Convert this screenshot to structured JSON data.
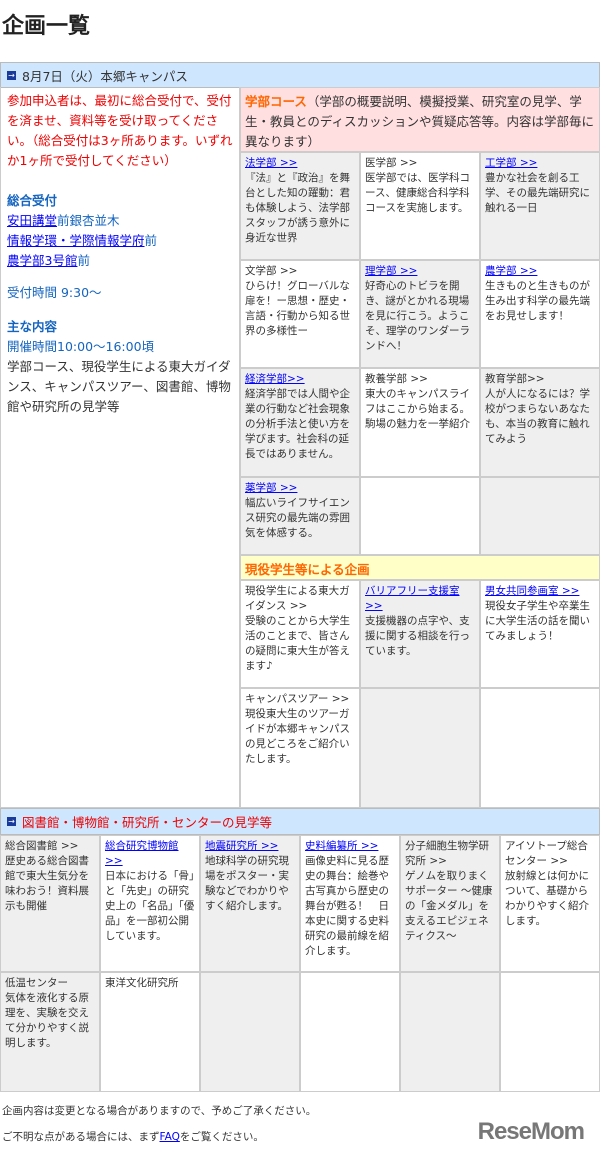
{
  "page_title": "企画一覧",
  "section1": {
    "header": "8月7日（火）本郷キャンパス",
    "notice": "参加申込者は、最初に総合受付で、受付を済ませ、資料等を受け取ってください。（総合受付は3ヶ所あります。いずれか1ヶ所で受付してください）",
    "reception_heading": "総合受付",
    "locations": [
      {
        "link": "安田講堂",
        "suffix": "前銀杏並木"
      },
      {
        "link": "情報学環・学際情報学府",
        "suffix": "前"
      },
      {
        "link": "農学部3号館",
        "suffix": "前"
      }
    ],
    "reception_time": "受付時間 9:30〜",
    "content_heading": "主な内容",
    "open_time": "開催時間10:00〜16:00頃",
    "content_desc": "学部コース、現役学生による東大ガイダンス、キャンパスツアー、図書館、博物館や研究所の見学等",
    "faculty_title": "学部コース",
    "faculty_desc": "（学部の概要説明、模擬授業、研究室の見学、学生・教員とのディスカッションや質疑応答等。内容は学部毎に異なります）",
    "faculty_cells": [
      {
        "title": "法学部 >>",
        "link": true,
        "gray": true,
        "desc": "『法』と『政治』を舞台とした知の躍動：君も体験しよう、法学部スタッフが誘う意外に身近な世界"
      },
      {
        "title": "医学部 >>",
        "link": false,
        "gray": false,
        "desc": "医学部では、医学科コース、健康総合科学科コースを実施します。"
      },
      {
        "title": "工学部 >>",
        "link": true,
        "gray": true,
        "desc": "豊かな社会を創る工学、その最先端研究に触れる一日"
      },
      {
        "title": "文学部 >>",
        "link": false,
        "gray": false,
        "desc": "ひらけ！グローバルな扉を！ー思想・歴史・言語・行動から知る世界の多様性ー"
      },
      {
        "title": "理学部 >>",
        "link": true,
        "gray": true,
        "desc": "好奇心のトビラを開き、謎がとかれる現場を見に行こう。ようこそ、理学のワンダーランドへ！"
      },
      {
        "title": "農学部 >>",
        "link": true,
        "gray": false,
        "desc": "生きものと生きものが生み出す科学の最先端をお見せします！"
      },
      {
        "title": "経済学部>>",
        "link": true,
        "gray": true,
        "desc": "経済学部では人間や企業の行動など社会現象の分析手法と使い方を学びます。社会科の延長ではありません。"
      },
      {
        "title": "教養学部 >>",
        "link": false,
        "gray": false,
        "desc": "東大のキャンパスライフはここから始まる。駒場の魅力を一挙紹介"
      },
      {
        "title": "教育学部>>",
        "link": false,
        "gray": true,
        "desc": "人が人になるには？学校がつまらないあなたも、本当の教育に触れてみよう"
      },
      {
        "title": "薬学部 >>",
        "link": true,
        "gray": true,
        "desc": "幅広いライフサイエンス研究の最先端の雰囲気を体感する。"
      },
      {
        "title": "",
        "link": false,
        "gray": false,
        "desc": ""
      },
      {
        "title": "",
        "link": false,
        "gray": true,
        "desc": ""
      }
    ],
    "student_title": "現役学生等による企画",
    "student_cells": [
      {
        "title": "現役学生による東大ガイダンス >>",
        "link": false,
        "gray": false,
        "desc": "受験のことから大学生活のことまで、皆さんの疑問に東大生が答えます♪"
      },
      {
        "title": "バリアフリー支援室 >>",
        "link": true,
        "gray": true,
        "desc": "支援機器の点字や、支援に関する相談を行っています。"
      },
      {
        "title": "男女共同参画室 >>",
        "link": true,
        "gray": false,
        "desc": "現役女子学生や卒業生に大学生活の話を聞いてみましょう！"
      },
      {
        "title": "キャンパスツアー >>",
        "link": false,
        "gray": false,
        "desc": "現役東大生のツアーガイドが本郷キャンパスの見どころをご紹介いたします。"
      },
      {
        "title": "",
        "link": false,
        "gray": true,
        "desc": ""
      },
      {
        "title": "",
        "link": false,
        "gray": false,
        "desc": ""
      }
    ]
  },
  "section2": {
    "header": "図書館・博物館・研究所・センターの見学等",
    "cells": [
      {
        "title": "総合図書館 >>",
        "link": false,
        "gray": true,
        "desc": "歴史ある総合図書館で東大生気分を味わおう！資料展示も開催"
      },
      {
        "title": "総合研究博物館 >>",
        "link": true,
        "gray": false,
        "desc": "日本における「骨」と「先史」の研究史上の「名品」「優品」を一部初公開しています。"
      },
      {
        "title": "地震研究所 >>",
        "link": true,
        "gray": true,
        "desc": "地球科学の研究現場をポスター・実験などでわかりやすく紹介します。"
      },
      {
        "title": "史料編纂所 >>",
        "link": true,
        "gray": false,
        "desc": "画像史料に見る歴史の舞台：絵巻や古写真から歴史の舞台が甦る！　日本史に関する史料研究の最前線を紹介します。"
      },
      {
        "title": "分子細胞生物学研究所 >>",
        "link": false,
        "gray": true,
        "desc": "ゲノムを取りまくサポーター 〜健康の「金メダル」を支えるエピジェネティクス〜"
      },
      {
        "title": "アイソトープ総合センター >>",
        "link": false,
        "gray": false,
        "desc": "放射線とは何かについて、基礎からわかりやすく紹介します。"
      },
      {
        "title": "低温センター",
        "link": false,
        "gray": true,
        "desc": "気体を液化する原理を、実験を交えて分かりやすく説明します。"
      },
      {
        "title": "東洋文化研究所",
        "link": false,
        "gray": false,
        "desc": ""
      },
      {
        "title": "",
        "link": false,
        "gray": true,
        "desc": ""
      },
      {
        "title": "",
        "link": false,
        "gray": false,
        "desc": ""
      },
      {
        "title": "",
        "link": false,
        "gray": true,
        "desc": ""
      },
      {
        "title": "",
        "link": false,
        "gray": false,
        "desc": ""
      }
    ]
  },
  "footer": {
    "note": "企画内容は変更となる場合がありますので、予めご了承ください。",
    "faq_prefix": "ご不明な点がある場合には、まず",
    "faq_link": "FAQ",
    "faq_suffix": "をご覧ください。"
  },
  "logo": "ReseMom"
}
